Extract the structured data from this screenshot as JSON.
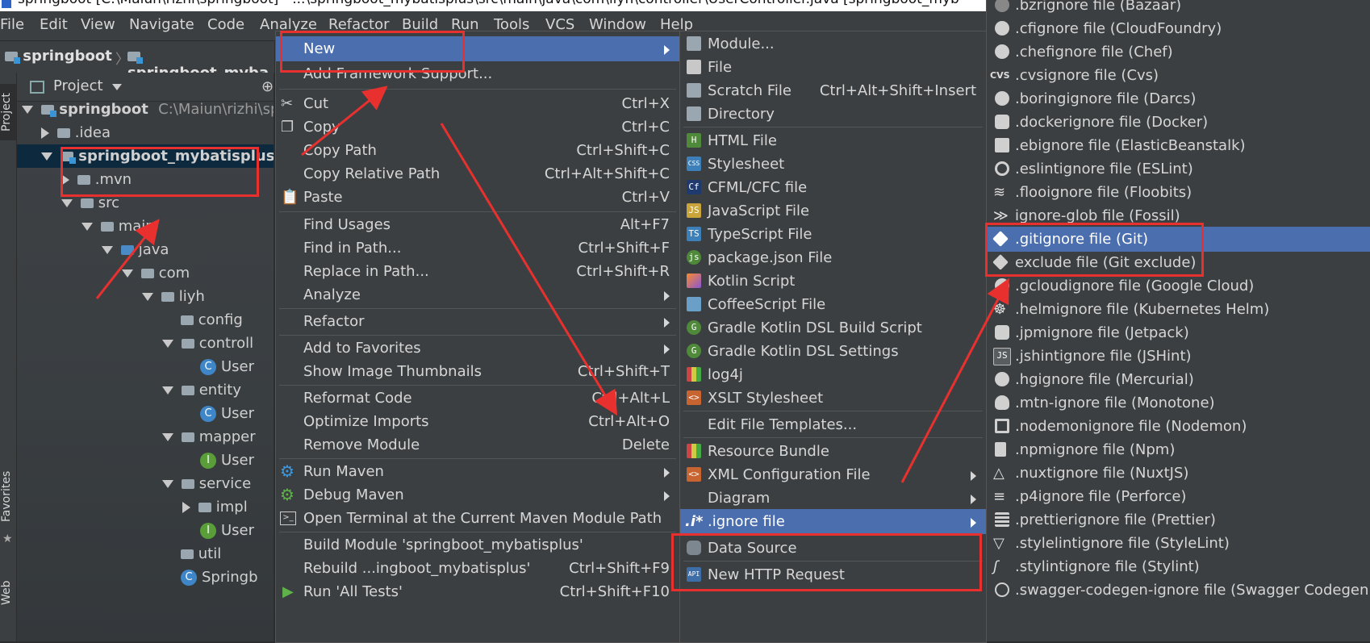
{
  "title_bar": {
    "text": "springboot [C:\\Maiun\\rizhi\\springboot] - ...\\springboot_mybatisplus\\src\\main\\java\\com\\liyh\\controller\\UserController.java [springboot_myb"
  },
  "menubar": [
    "File",
    "Edit",
    "View",
    "Navigate",
    "Code",
    "Analyze",
    "Refactor",
    "Build",
    "Run",
    "Tools",
    "VCS",
    "Window",
    "Help"
  ],
  "navbar": {
    "crumb1": "springboot",
    "crumb2": "springboot_myba"
  },
  "side_tabs": {
    "project": "Project",
    "favorites": "Favorites",
    "web": "Web"
  },
  "project_panel": {
    "header": "Project",
    "tree": [
      {
        "label": "springboot",
        "extra": "C:\\Maiun\\rizhi\\sp"
      },
      {
        "label": ".idea"
      },
      {
        "label": "springboot_mybatisplus"
      },
      {
        "label": ".mvn"
      },
      {
        "label": "src"
      },
      {
        "label": "main"
      },
      {
        "label": "java"
      },
      {
        "label": "com"
      },
      {
        "label": "liyh"
      },
      {
        "label": "config"
      },
      {
        "label": "controll"
      },
      {
        "label": "User"
      },
      {
        "label": "entity"
      },
      {
        "label": "User"
      },
      {
        "label": "mapper"
      },
      {
        "label": "User"
      },
      {
        "label": "service"
      },
      {
        "label": "impl"
      },
      {
        "label": "User"
      },
      {
        "label": "util"
      },
      {
        "label": "Springb"
      }
    ]
  },
  "context_menu": [
    {
      "label": "New",
      "shortcut": "",
      "submenu": true
    },
    {
      "label": "Add Framework Support...",
      "shortcut": ""
    },
    {
      "label": "Cut",
      "shortcut": "Ctrl+X"
    },
    {
      "label": "Copy",
      "shortcut": "Ctrl+C"
    },
    {
      "label": "Copy Path",
      "shortcut": "Ctrl+Shift+C"
    },
    {
      "label": "Copy Relative Path",
      "shortcut": "Ctrl+Alt+Shift+C"
    },
    {
      "label": "Paste",
      "shortcut": "Ctrl+V"
    },
    {
      "label": "Find Usages",
      "shortcut": "Alt+F7"
    },
    {
      "label": "Find in Path...",
      "shortcut": "Ctrl+Shift+F"
    },
    {
      "label": "Replace in Path...",
      "shortcut": "Ctrl+Shift+R"
    },
    {
      "label": "Analyze",
      "shortcut": "",
      "submenu": true
    },
    {
      "label": "Refactor",
      "shortcut": "",
      "submenu": true
    },
    {
      "label": "Add to Favorites",
      "shortcut": "",
      "submenu": true
    },
    {
      "label": "Show Image Thumbnails",
      "shortcut": "Ctrl+Shift+T"
    },
    {
      "label": "Reformat Code",
      "shortcut": "Ctrl+Alt+L"
    },
    {
      "label": "Optimize Imports",
      "shortcut": "Ctrl+Alt+O"
    },
    {
      "label": "Remove Module",
      "shortcut": "Delete"
    },
    {
      "label": "Run Maven",
      "shortcut": "",
      "submenu": true
    },
    {
      "label": "Debug Maven",
      "shortcut": "",
      "submenu": true
    },
    {
      "label": "Open Terminal at the Current Maven Module Path",
      "shortcut": ""
    },
    {
      "label": "Build Module 'springboot_mybatisplus'",
      "shortcut": ""
    },
    {
      "label": "Rebuild ...ingboot_mybatisplus'",
      "shortcut": "Ctrl+Shift+F9"
    },
    {
      "label": "Run 'All Tests'",
      "shortcut": "Ctrl+Shift+F10"
    }
  ],
  "new_submenu": [
    {
      "label": "Module...",
      "shortcut": ""
    },
    {
      "label": "File",
      "shortcut": ""
    },
    {
      "label": "Scratch File",
      "shortcut": "Ctrl+Alt+Shift+Insert"
    },
    {
      "label": "Directory",
      "shortcut": ""
    },
    {
      "label": "HTML File",
      "shortcut": ""
    },
    {
      "label": "Stylesheet",
      "shortcut": ""
    },
    {
      "label": "CFML/CFC file",
      "shortcut": ""
    },
    {
      "label": "JavaScript File",
      "shortcut": ""
    },
    {
      "label": "TypeScript File",
      "shortcut": ""
    },
    {
      "label": "package.json File",
      "shortcut": ""
    },
    {
      "label": "Kotlin Script",
      "shortcut": ""
    },
    {
      "label": "CoffeeScript File",
      "shortcut": ""
    },
    {
      "label": "Gradle Kotlin DSL Build Script",
      "shortcut": ""
    },
    {
      "label": "Gradle Kotlin DSL Settings",
      "shortcut": ""
    },
    {
      "label": "log4j",
      "shortcut": ""
    },
    {
      "label": "XSLT Stylesheet",
      "shortcut": ""
    },
    {
      "label": "Edit File Templates...",
      "shortcut": ""
    },
    {
      "label": "Resource Bundle",
      "shortcut": ""
    },
    {
      "label": "XML Configuration File",
      "shortcut": "",
      "submenu": true
    },
    {
      "label": "Diagram",
      "shortcut": "",
      "submenu": true
    },
    {
      "label": ".ignore file",
      "shortcut": "",
      "submenu": true
    },
    {
      "label": "Data Source",
      "shortcut": ""
    },
    {
      "label": "New HTTP Request",
      "shortcut": ""
    }
  ],
  "ignore_submenu": [
    ".bzrignore file (Bazaar)",
    ".cfignore file (CloudFoundry)",
    ".chefignore file (Chef)",
    ".cvsignore file (Cvs)",
    ".boringignore file (Darcs)",
    ".dockerignore file (Docker)",
    ".ebignore file (ElasticBeanstalk)",
    ".eslintignore file (ESLint)",
    ".flooignore file (Floobits)",
    "ignore-glob file (Fossil)",
    ".gitignore file (Git)",
    "exclude file (Git exclude)",
    ".gcloudignore file (Google Cloud)",
    ".helmignore file (Kubernetes Helm)",
    ".jpmignore file (Jetpack)",
    ".jshintignore file (JSHint)",
    ".hgignore file (Mercurial)",
    ".mtn-ignore file (Monotone)",
    ".nodemonignore file (Nodemon)",
    ".npmignore file (Npm)",
    ".nuxtignore file (NuxtJS)",
    ".p4ignore file (Perforce)",
    ".prettierignore file (Prettier)",
    ".stylelintignore file (StyleLint)",
    ".stylintignore file (Stylint)",
    ".swagger-codegen-ignore file (Swagger Codegen)"
  ],
  "ignore_icons": {
    "cvs_label": "CVS",
    "jshint_label": "JS",
    "ignore_file_glyph": ".i*"
  },
  "colors": {
    "selection": "#4b6eaf",
    "annotation": "#e8312f",
    "menu_bg": "#3c3f41"
  }
}
